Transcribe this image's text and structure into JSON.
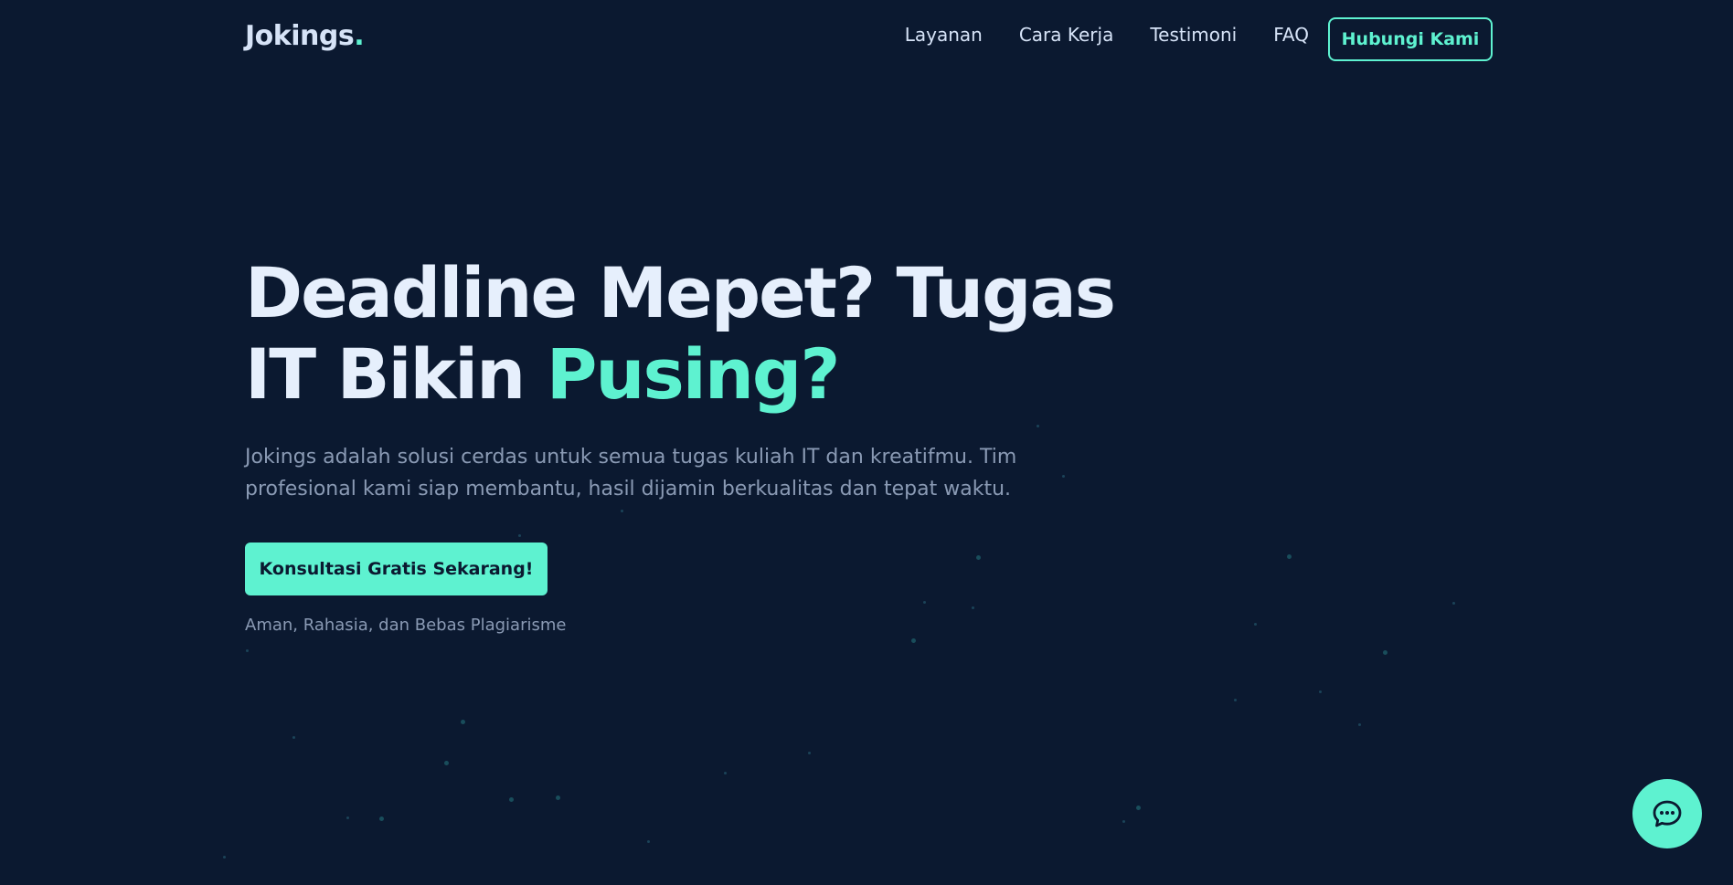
{
  "brand": {
    "name": "Jokings",
    "dot": ".",
    "accent_color": "#5ef2d0",
    "background_color": "#0b1930"
  },
  "nav": {
    "links": [
      "Layanan",
      "Cara Kerja",
      "Testimoni",
      "FAQ"
    ],
    "cta_label": "Hubungi Kami"
  },
  "hero": {
    "title_line1": "Deadline Mepet? Tugas",
    "title_line2_plain": "IT Bikin ",
    "title_line2_accent": "Pusing?",
    "description": "Jokings adalah solusi cerdas untuk semua tugas kuliah IT dan kreatifmu. Tim profesional kami siap membantu, hasil dijamin berkualitas dan tepat waktu.",
    "cta_label": "Konsultasi Gratis Sekarang!",
    "note": "Aman, Rahasia, dan Bebas Plagiarisme"
  },
  "chat": {
    "icon": "chat-bubble-icon"
  }
}
